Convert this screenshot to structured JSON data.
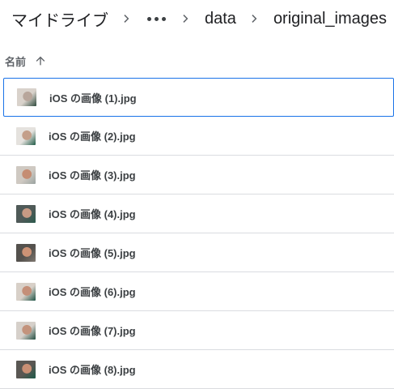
{
  "breadcrumb": {
    "root": "マイドライブ",
    "folder1": "data",
    "folder2": "original_images"
  },
  "column": {
    "name_label": "名前"
  },
  "files": [
    {
      "name": "iOS の画像 (1).jpg",
      "thumb_colors": [
        "#d9d2cb",
        "#b8a69b",
        "#2e4a3d"
      ]
    },
    {
      "name": "iOS の画像 (2).jpg",
      "thumb_colors": [
        "#e5e2de",
        "#c49f8a",
        "#1f5a46"
      ]
    },
    {
      "name": "iOS の画像 (3).jpg",
      "thumb_colors": [
        "#cfc9c2",
        "#c58d73",
        "#9aa3a0"
      ]
    },
    {
      "name": "iOS の画像 (4).jpg",
      "thumb_colors": [
        "#4f5a58",
        "#c79a84",
        "#2c5b4d"
      ]
    },
    {
      "name": "iOS の画像 (5).jpg",
      "thumb_colors": [
        "#54514d",
        "#cc9275",
        "#7f7770"
      ]
    },
    {
      "name": "iOS の画像 (6).jpg",
      "thumb_colors": [
        "#d8d0c8",
        "#c48f78",
        "#1f5447"
      ]
    },
    {
      "name": "iOS の画像 (7).jpg",
      "thumb_colors": [
        "#d6d0ca",
        "#c3937c",
        "#244f43"
      ]
    },
    {
      "name": "iOS の画像 (8).jpg",
      "thumb_colors": [
        "#5a5753",
        "#c98f74",
        "#1e5a49"
      ]
    }
  ],
  "selected_index": 0,
  "colors": {
    "accent": "#1a73e8",
    "divider": "#dadce0",
    "text": "#3c4043"
  }
}
